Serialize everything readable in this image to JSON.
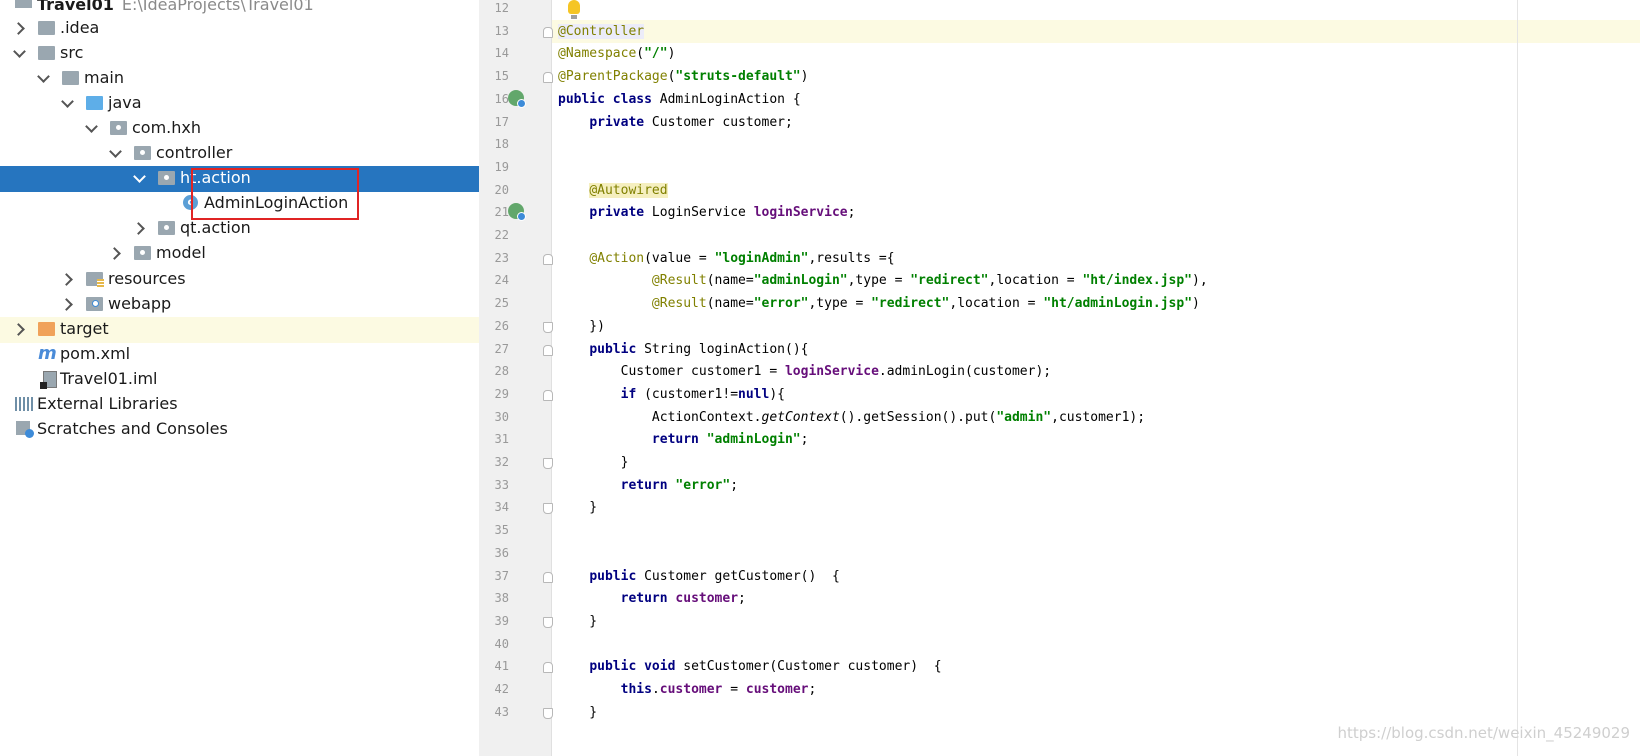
{
  "tree": {
    "project": {
      "name": "Travel01",
      "path": "E:\\IdeaProjects\\Travel01"
    },
    "items": [
      {
        "label": ".idea"
      },
      {
        "label": "src"
      },
      {
        "label": "main"
      },
      {
        "label": "java"
      },
      {
        "label": "com.hxh"
      },
      {
        "label": "controller"
      },
      {
        "label": "ht.action"
      },
      {
        "label": "AdminLoginAction"
      },
      {
        "label": "qt.action"
      },
      {
        "label": "model"
      },
      {
        "label": "resources"
      },
      {
        "label": "webapp"
      },
      {
        "label": "target"
      },
      {
        "label": "pom.xml"
      },
      {
        "label": "Travel01.iml"
      },
      {
        "label": "External Libraries"
      },
      {
        "label": "Scratches and Consoles"
      }
    ]
  },
  "editor": {
    "lines": [
      {
        "n": "12",
        "text": ""
      },
      {
        "n": "13",
        "text": "@Controller"
      },
      {
        "n": "14",
        "text": "@Namespace(\"/\")"
      },
      {
        "n": "15",
        "text": "@ParentPackage(\"struts-default\")"
      },
      {
        "n": "16",
        "text": "public class AdminLoginAction {"
      },
      {
        "n": "17",
        "text": "    private Customer customer;"
      },
      {
        "n": "18",
        "text": ""
      },
      {
        "n": "19",
        "text": ""
      },
      {
        "n": "20",
        "text": "    @Autowired"
      },
      {
        "n": "21",
        "text": "    private LoginService loginService;"
      },
      {
        "n": "22",
        "text": ""
      },
      {
        "n": "23",
        "text": "    @Action(value = \"loginAdmin\",results ={"
      },
      {
        "n": "24",
        "text": "            @Result(name=\"adminLogin\",type = \"redirect\",location = \"ht/index.jsp\"),"
      },
      {
        "n": "25",
        "text": "            @Result(name=\"error\",type = \"redirect\",location = \"ht/adminLogin.jsp\")"
      },
      {
        "n": "26",
        "text": "    })"
      },
      {
        "n": "27",
        "text": "    public String loginAction(){"
      },
      {
        "n": "28",
        "text": "        Customer customer1 = loginService.adminLogin(customer);"
      },
      {
        "n": "29",
        "text": "        if (customer1!=null){"
      },
      {
        "n": "30",
        "text": "            ActionContext.getContext().getSession().put(\"admin\",customer1);"
      },
      {
        "n": "31",
        "text": "            return \"adminLogin\";"
      },
      {
        "n": "32",
        "text": "        }"
      },
      {
        "n": "33",
        "text": "        return \"error\";"
      },
      {
        "n": "34",
        "text": "    }"
      },
      {
        "n": "35",
        "text": ""
      },
      {
        "n": "36",
        "text": ""
      },
      {
        "n": "37",
        "text": "    public Customer getCustomer()  {"
      },
      {
        "n": "38",
        "text": "        return customer;"
      },
      {
        "n": "39",
        "text": "    }"
      },
      {
        "n": "40",
        "text": ""
      },
      {
        "n": "41",
        "text": "    public void setCustomer(Customer customer)  {"
      },
      {
        "n": "42",
        "text": "        this.customer = customer;"
      },
      {
        "n": "43",
        "text": "    }"
      }
    ]
  },
  "colors": {
    "keyword": "#000080",
    "annotation": "#808000",
    "string": "#008000",
    "field": "#660e7a",
    "selection": "#2675bf",
    "current_line": "#fcfae2"
  },
  "watermark": "https://blog.csdn.net/weixin_45249029"
}
